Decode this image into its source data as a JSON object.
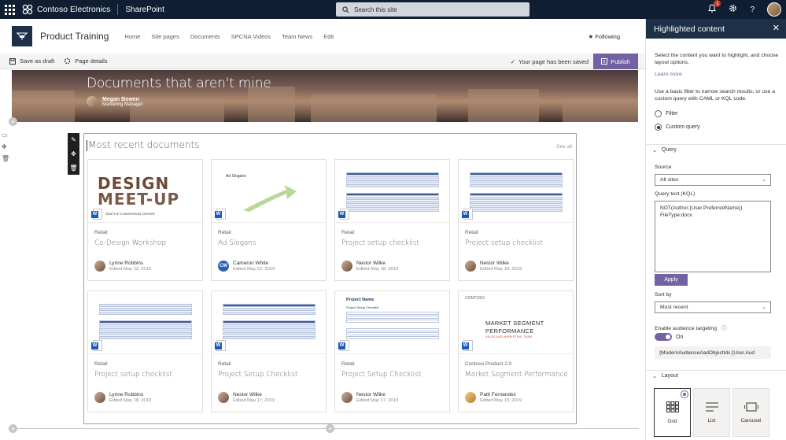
{
  "suitebar": {
    "org_name": "Contoso Electronics",
    "app_name": "SharePoint",
    "search_placeholder": "Search this site",
    "notification_count": "1"
  },
  "site": {
    "title": "Product Training",
    "nav": [
      "Home",
      "Site pages",
      "Documents",
      "SPCNA Videos",
      "Team News",
      "Edit"
    ],
    "following": "Following"
  },
  "commandbar": {
    "save_draft": "Save as draft",
    "page_details": "Page details",
    "saved_status": "Your page has been saved",
    "publish": "Publish"
  },
  "hero": {
    "title": "Documents that aren't mine",
    "author_name": "Megan Bowen",
    "author_role": "Marketing Manager"
  },
  "webpart": {
    "title": "Most recent documents",
    "see_all": "See all",
    "cards": [
      {
        "category": "Retail",
        "title": "Co-Design Workshop",
        "person": "Lynne Robbins",
        "edited": "Edited May 22, 2019",
        "thumb": "design",
        "initials": ""
      },
      {
        "category": "Retail",
        "title": "Ad Slogans",
        "person": "Cameron White",
        "edited": "Edited May 22, 2019",
        "thumb": "slogans",
        "initials": "CW"
      },
      {
        "category": "Retail",
        "title": "Project setup checklist",
        "person": "Nestor Wilke",
        "edited": "Edited May 18, 2019",
        "thumb": "table",
        "initials": ""
      },
      {
        "category": "Retail",
        "title": "Project setup checklist",
        "person": "Nestor Wilke",
        "edited": "Edited May 18, 2019",
        "thumb": "table",
        "initials": ""
      },
      {
        "category": "Retail",
        "title": "Project setup checklist",
        "person": "Lynne Robbins",
        "edited": "Edited May 18, 2019",
        "thumb": "table",
        "initials": ""
      },
      {
        "category": "Retail",
        "title": "Project Setup Checklist",
        "person": "Nestor Wilke",
        "edited": "Edited May 17, 2019",
        "thumb": "table",
        "initials": ""
      },
      {
        "category": "Retail",
        "title": "Project Setup Checklist",
        "person": "Nestor Wilke",
        "edited": "Edited May 17, 2019",
        "thumb": "projname",
        "initials": ""
      },
      {
        "category": "Contoso Product 2.0",
        "title": "Market Segment Performance",
        "person": "Patti Fernandez",
        "edited": "Edited May 15, 2019",
        "thumb": "market",
        "initials": ""
      }
    ],
    "thumb_text": {
      "design_line1": "DESIGN",
      "design_line2": "MEET-UP",
      "design_sub": "SEATTLE CONVENTION CENTER",
      "slogans": "Ad Slogans",
      "proj_name": "Project Name",
      "proj_sub": "Project Setup Checklist",
      "contoso": "CONTOSO",
      "market1": "MARKET SEGMENT",
      "market2": "PERFORMANCE",
      "market3": "SALES AND MARKETING TEAM",
      "word_letter": "W"
    }
  },
  "panel": {
    "title": "Highlighted content",
    "intro": "Select the content you want to highlight, and choose layout options.",
    "learn_more": "Learn more",
    "filter_intro": "Use a basic filter to narrow search results, or use a custom query with CAML or KQL code.",
    "radio_filter": "Filter",
    "radio_custom": "Custom query",
    "query_section": "Query",
    "source_label": "Source",
    "source_value": "All sites",
    "kql_label": "Query text (KQL)",
    "kql_value": "NOT(Author:{User.PreferredName})\nFileType:docx",
    "apply": "Apply",
    "sort_label": "Sort by",
    "sort_value": "Most recent",
    "audience_label": "Enable audience targeting",
    "toggle_state": "On",
    "audience_value": "{ModernAudienceAadObjectIds:{User.Aud",
    "layout_section": "Layout",
    "layouts": [
      "Grid",
      "List",
      "Carousel"
    ]
  }
}
